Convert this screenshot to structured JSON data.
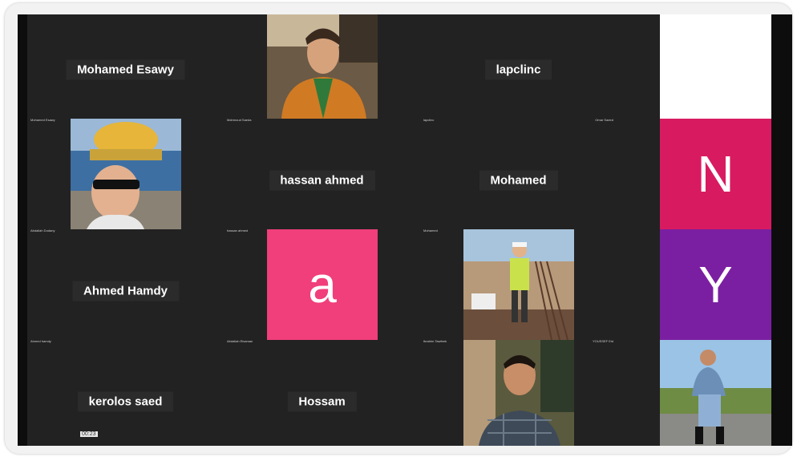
{
  "participants": [
    {
      "name": "Mohamed Esawy",
      "tag": "Mohamed Esawy"
    },
    {
      "name": "",
      "tag": "Mahmoud Saeda"
    },
    {
      "name": "lapclinc",
      "tag": "lapclinc"
    },
    {
      "name": "",
      "tag": "Omar Saeed"
    },
    {
      "name": "",
      "tag": "Abdallah Dodany"
    },
    {
      "name": "hassan ahmed",
      "tag": "hassan ahmed"
    },
    {
      "name": "Mohamed",
      "tag": "Mohamed"
    },
    {
      "name": "Ahmed Hamdy",
      "tag": "Ahmed hamdy"
    },
    {
      "name": "",
      "tag": "Abdallah Elsaman"
    },
    {
      "name": "",
      "tag": "Ibrahim Tawfeek"
    },
    {
      "name": "",
      "tag": "YOUSSEF Eid"
    },
    {
      "name": "kerolos saed",
      "tag": "kerolos saed"
    },
    {
      "name": "Hossam",
      "tag": "Hossam"
    }
  ],
  "avatars": {
    "a": "a",
    "n": "N",
    "y": "Y"
  },
  "timestamp": "00:23",
  "colors": {
    "a_bg": "#f03f7b",
    "n_bg": "#d81b60",
    "y_bg": "#7b1fa2",
    "bg": "#222222"
  }
}
